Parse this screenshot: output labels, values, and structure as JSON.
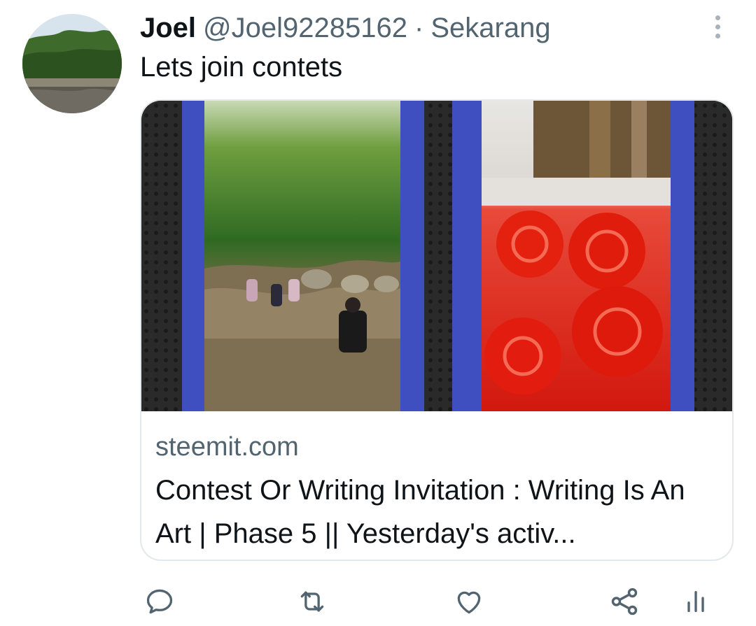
{
  "tweet": {
    "author_name": "Joel",
    "author_handle": "@Joel92285162",
    "separator": "·",
    "timestamp": "Sekarang",
    "text": "Lets join contets"
  },
  "link_card": {
    "domain": "steemit.com",
    "title": "Contest Or Writing Invitation : Writing Is An Art | Phase 5 || Yesterday's activ..."
  },
  "icons": {
    "more": "more-vertical-icon",
    "reply": "reply-icon",
    "retweet": "retweet-icon",
    "like": "heart-icon",
    "share": "share-icon",
    "analytics": "analytics-icon"
  },
  "colors": {
    "primary_text": "#0f1419",
    "secondary_text": "#536471",
    "icon": "#536471",
    "card_border": "#e2e8ec",
    "media_stripe": "#3f4fc0"
  }
}
